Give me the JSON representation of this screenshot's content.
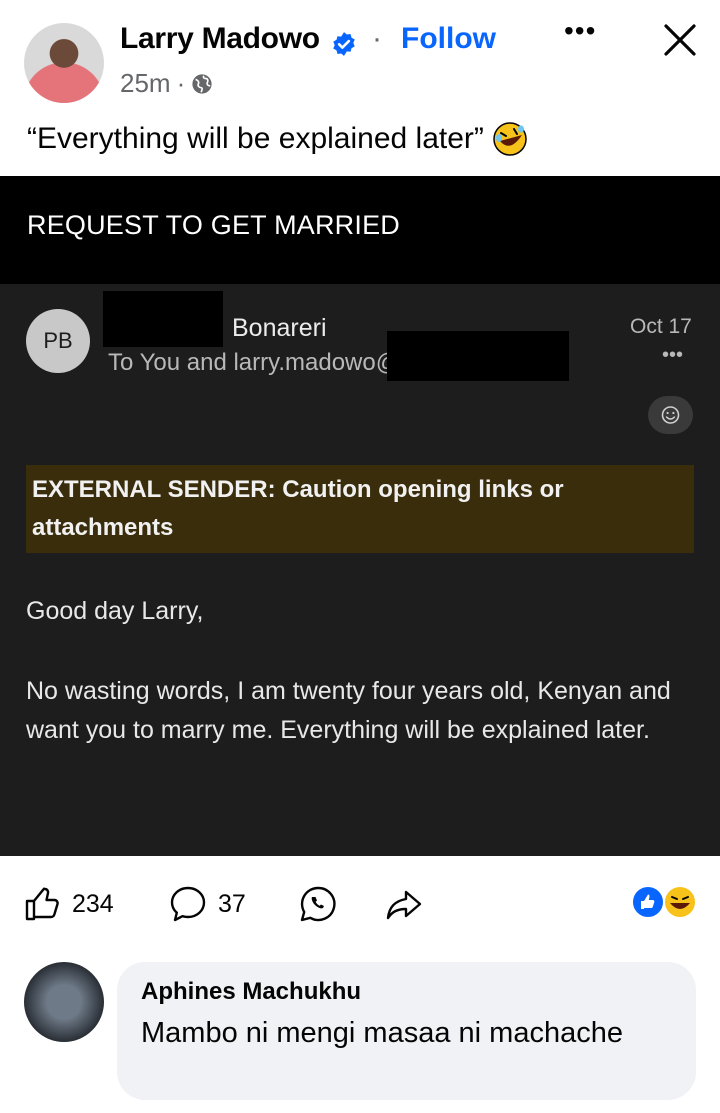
{
  "post": {
    "author": "Larry Madowo",
    "separator": "·",
    "follow_label": "Follow",
    "more_label": "•••",
    "timestamp": "25m",
    "meta_separator": "·",
    "privacy_icon": "globe-icon",
    "caption": "“Everything will be explained later”",
    "caption_emoji": "rolling-on-floor-laughing-emoji"
  },
  "image": {
    "banner_title": "REQUEST TO GET MARRIED",
    "email": {
      "avatar_initials": "PB",
      "sender_name": "Bonareri",
      "to_line": "To You and larry.madowo@",
      "date": "Oct 17",
      "more_label": "•••",
      "caution_text": "EXTERNAL SENDER: Caution opening links or attachments",
      "greeting": "Good day Larry,",
      "body": "No wasting words, I am twenty four years old, Kenyan and want you to marry me.  Everything will be explained later."
    }
  },
  "actions": {
    "like_count": "234",
    "comment_count": "37",
    "like_icon": "thumbs-up-icon",
    "comment_icon": "comment-icon",
    "whatsapp_icon": "whatsapp-icon",
    "share_icon": "share-icon",
    "reactions": [
      "like",
      "haha"
    ]
  },
  "comment": {
    "author": "Aphines Machukhu",
    "text": "Mambo ni mengi masaa ni machache"
  },
  "colors": {
    "accent": "#0866ff",
    "image_background": "#1d1d1d",
    "caution_background": "#3a2d0c",
    "comment_bubble": "#f0f2f5"
  }
}
